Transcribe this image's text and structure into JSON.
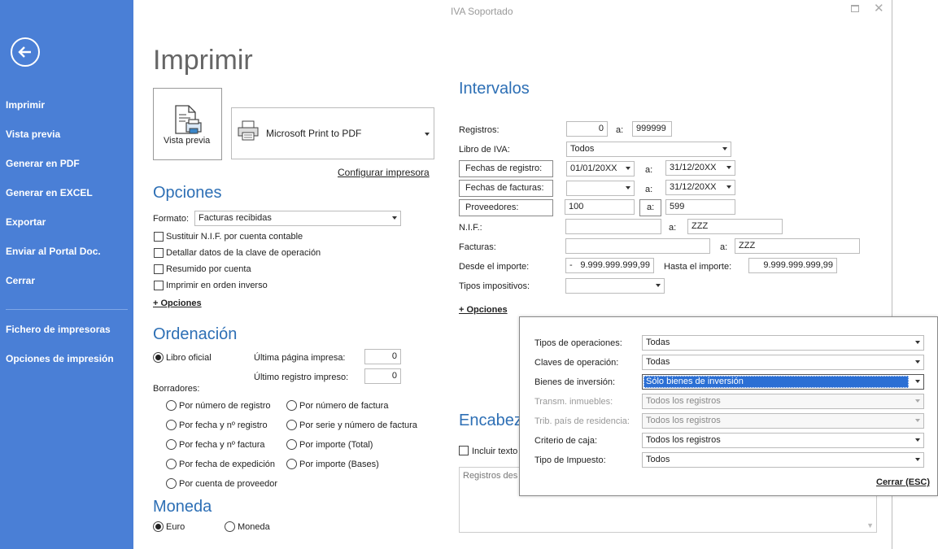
{
  "window": {
    "title": "IVA Soportado"
  },
  "sidebar": {
    "items": [
      "Imprimir",
      "Vista previa",
      "Generar en PDF",
      "Generar en EXCEL",
      "Exportar",
      "Enviar al Portal Doc.",
      "Cerrar"
    ],
    "items2": [
      "Fichero de impresoras",
      "Opciones de impresión"
    ]
  },
  "page": {
    "title": "Imprimir"
  },
  "preview": {
    "label": "Vista previa"
  },
  "printer": {
    "name": "Microsoft Print to PDF",
    "configure": "Configurar impresora"
  },
  "opciones": {
    "heading": "Opciones",
    "formato_label": "Formato:",
    "formato_value": "Facturas recibidas",
    "checks": [
      "Sustituir N.I.F. por cuenta contable",
      "Detallar datos de la clave de operación",
      "Resumido por cuenta",
      "Imprimir en orden inverso"
    ],
    "more": "+ Opciones"
  },
  "ordenacion": {
    "heading": "Ordenación",
    "libro": "Libro oficial",
    "ultima_pagina_label": "Última página impresa:",
    "ultima_pagina": "0",
    "ultimo_registro_label": "Último registro impreso:",
    "ultimo_registro": "0",
    "borradores": "Borradores:",
    "options": [
      "Por número de registro",
      "Por número de factura",
      "Por fecha y nº registro",
      "Por serie y número de factura",
      "Por fecha y nº factura",
      "Por importe (Total)",
      "Por fecha de expedición",
      "Por importe (Bases)",
      "Por cuenta de proveedor"
    ]
  },
  "moneda": {
    "heading": "Moneda",
    "euro": "Euro",
    "moneda": "Moneda"
  },
  "intervalos": {
    "heading": "Intervalos",
    "a": "a:",
    "registros_label": "Registros:",
    "registros_from": "0",
    "registros_to": "999999",
    "libro_label": "Libro de IVA:",
    "libro_value": "Todos",
    "fechas_registro": "Fechas de registro:",
    "fr_from": "01/01/20XX",
    "fr_to": "31/12/20XX",
    "fechas_facturas": "Fechas de facturas:",
    "ff_from": "",
    "ff_to": "31/12/20XX",
    "proveedores": "Proveedores:",
    "prov_from": "100",
    "prov_to": "599",
    "nif_label": "N.I.F.:",
    "nif_from": "",
    "nif_to": "ZZZ",
    "facturas_label": "Facturas:",
    "fact_from": "",
    "fact_to": "ZZZ",
    "desde_label": "Desde el importe:",
    "desde_value": "- 9.999.999.999,99",
    "hasta_label": "Hasta el importe:",
    "hasta_value": "9.999.999.999,99",
    "tipos_label": "Tipos impositivos:",
    "more": "+ Opciones"
  },
  "encabezado": {
    "heading": "Encabez",
    "incluir": "Incluir texto",
    "text": "Registros des"
  },
  "popup": {
    "rows": [
      {
        "label": "Tipos de operaciones:",
        "value": "Todas"
      },
      {
        "label": "Claves de operación:",
        "value": "Todas"
      },
      {
        "label": "Bienes de inversión:",
        "value": "Sólo bienes de inversión"
      },
      {
        "label": "Transm. inmuebles:",
        "value": "Todos los registros"
      },
      {
        "label": "Trib. país de residencia:",
        "value": "Todos los registros"
      },
      {
        "label": "Criterio de caja:",
        "value": "Todos los registros"
      },
      {
        "label": "Tipo de Impuesto:",
        "value": "Todos"
      }
    ],
    "close": "Cerrar (ESC)"
  }
}
